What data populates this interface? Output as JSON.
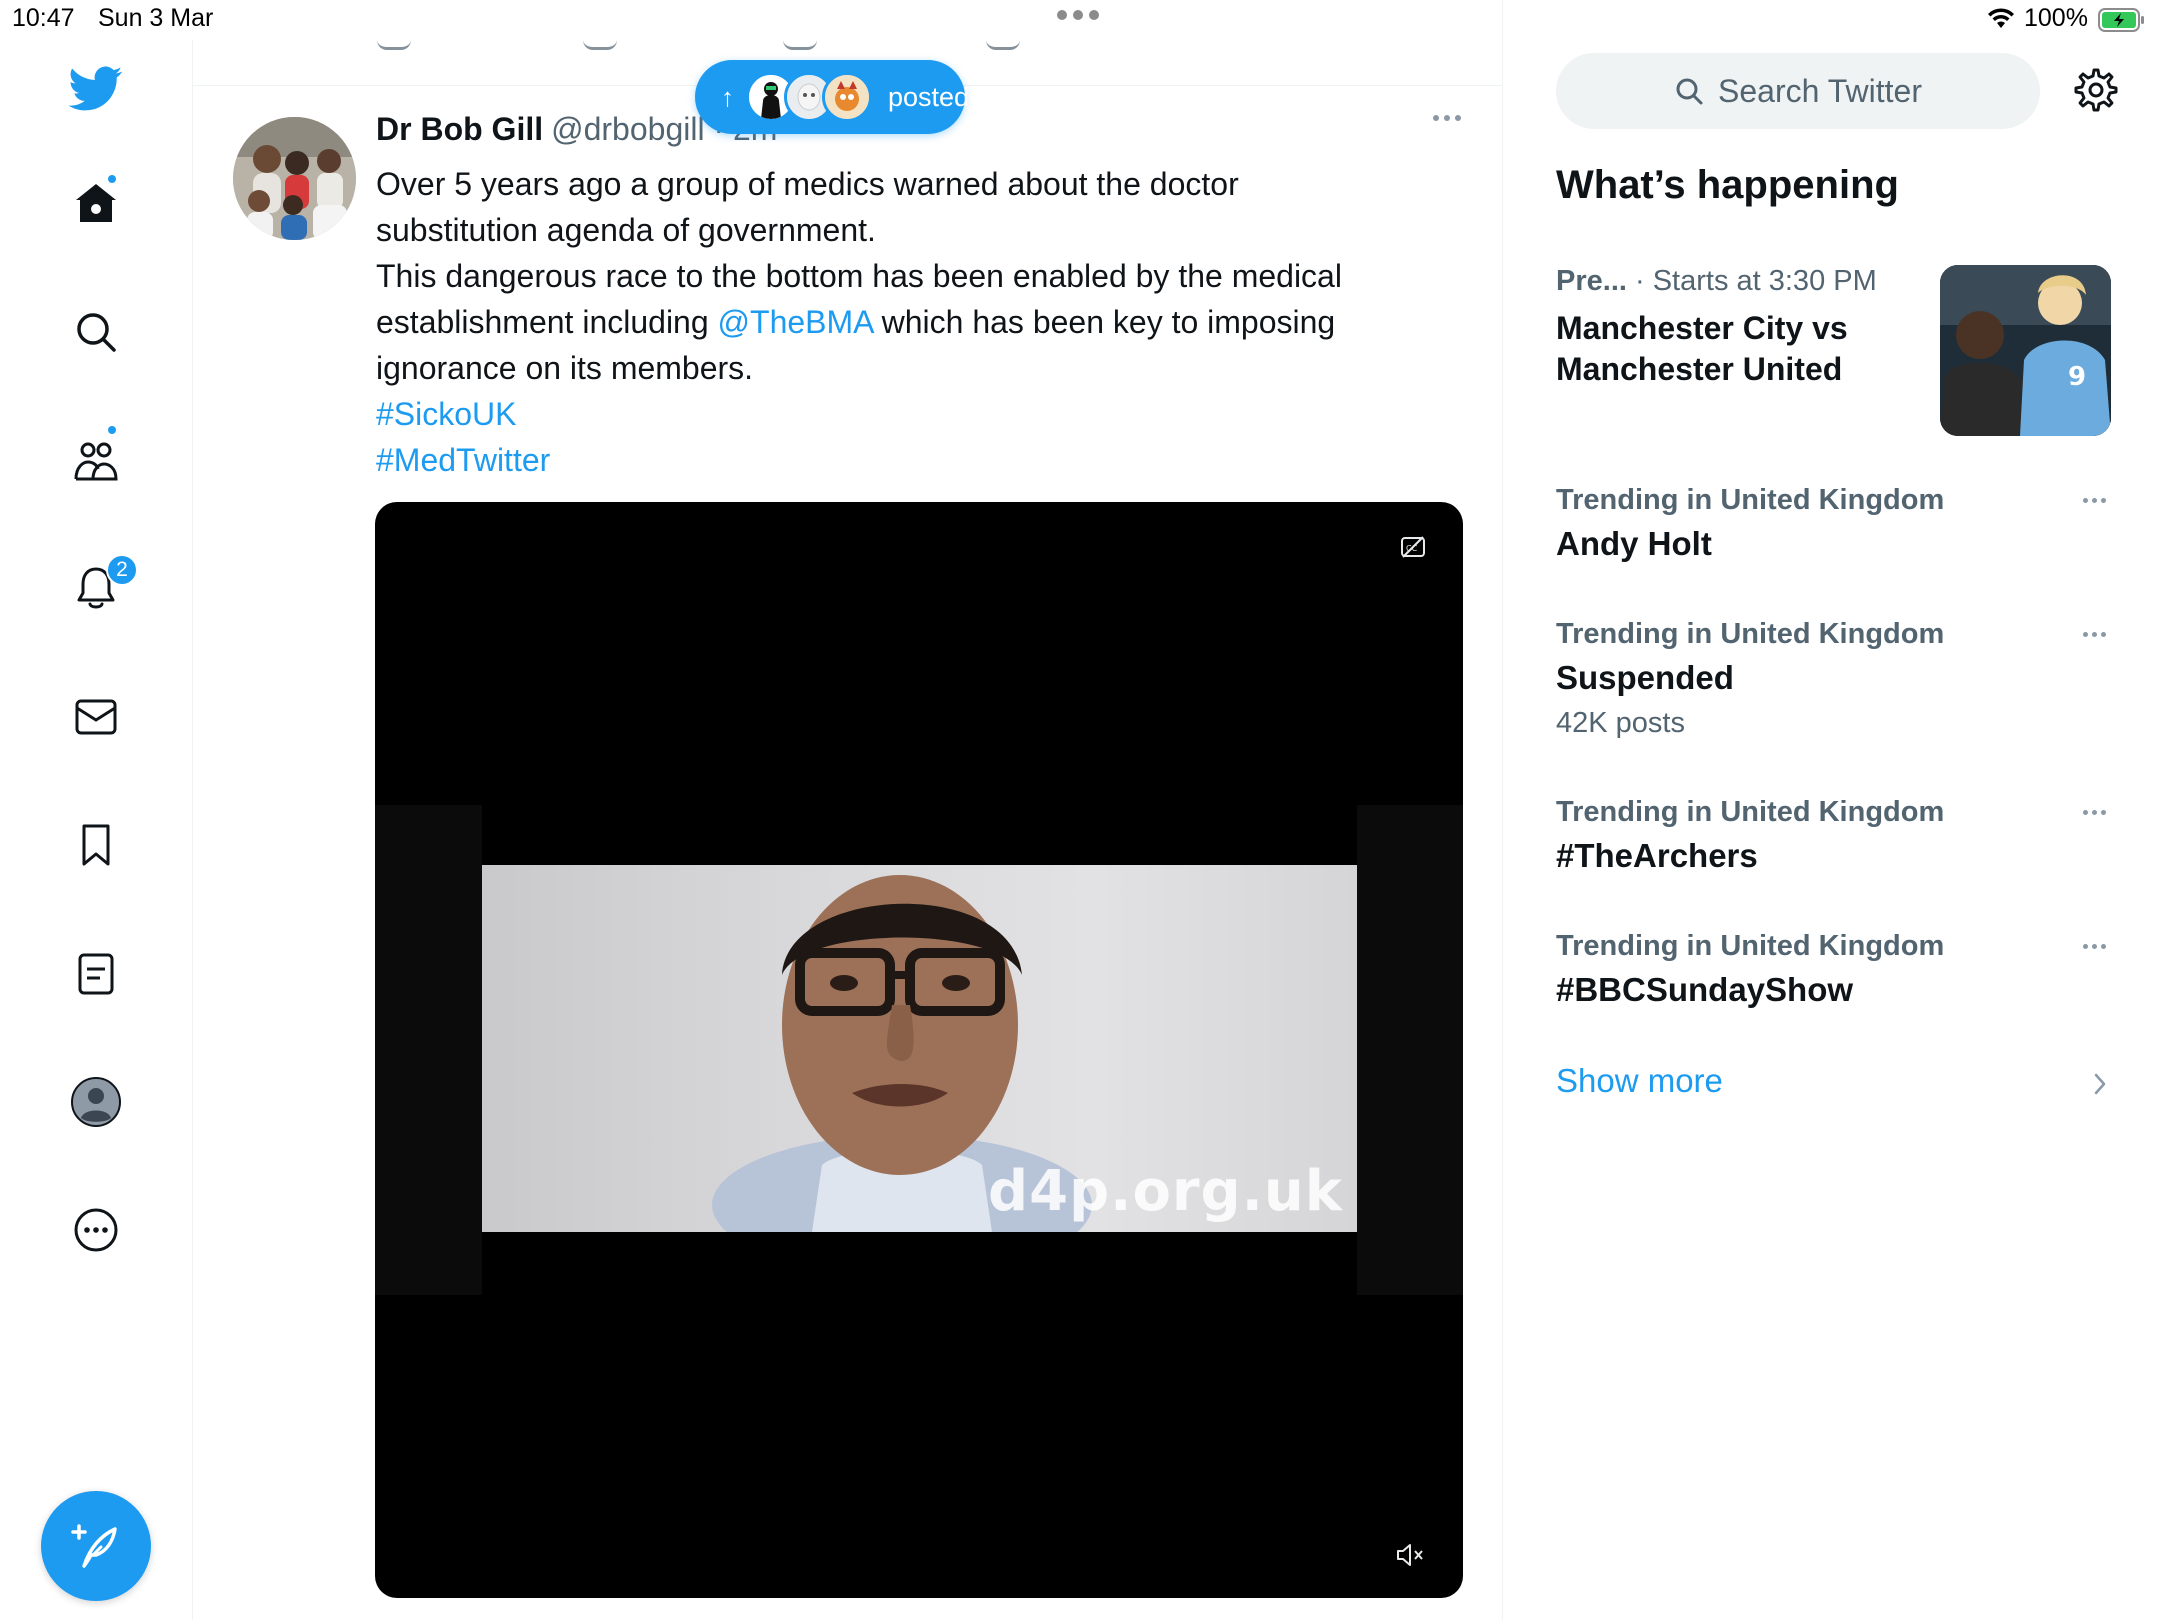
{
  "status_bar": {
    "time": "10:47",
    "date": "Sun 3 Mar",
    "battery": "100%"
  },
  "nav": {
    "items": [
      {
        "name": "logo",
        "icon": "twitter-bird-icon"
      },
      {
        "name": "home",
        "icon": "home-icon",
        "has_dot": true
      },
      {
        "name": "explore",
        "icon": "search-icon"
      },
      {
        "name": "communities",
        "icon": "communities-icon",
        "has_dot": true
      },
      {
        "name": "notifications",
        "icon": "bell-icon",
        "badge": "2"
      },
      {
        "name": "messages",
        "icon": "mail-icon"
      },
      {
        "name": "bookmarks",
        "icon": "bookmark-icon"
      },
      {
        "name": "lists",
        "icon": "list-icon"
      },
      {
        "name": "profile",
        "icon": "avatar-icon"
      },
      {
        "name": "more",
        "icon": "more-circle-icon"
      }
    ],
    "compose_icon": "compose-feather-icon"
  },
  "new_posts_pill": {
    "label": "posted"
  },
  "tweet": {
    "name": "Dr Bob Gill",
    "handle": "@drbobgill · 2m",
    "lines": {
      "l1": "Over 5 years ago a group of medics warned about the doctor",
      "l2": "substitution agenda of government.",
      "l3": "This dangerous race to the bottom has been enabled by the medical",
      "l4_pre": "establishment including ",
      "l4_mention": "@TheBMA",
      "l4_post": " which has been key to imposing",
      "l5": "ignorance on its members."
    },
    "hashtags": [
      "#SickoUK",
      "#MedTwitter"
    ],
    "media": {
      "watermark": "d4p.org.uk"
    }
  },
  "sidebar": {
    "search_placeholder": "Search Twitter",
    "section_title": "What’s happening",
    "featured": {
      "category": "Pre...",
      "time": " · Starts at 3:30 PM",
      "title": "Manchester City vs Manchester United"
    },
    "trends": [
      {
        "context": "Trending in United Kingdom",
        "name": "Andy Holt",
        "count": ""
      },
      {
        "context": "Trending in United Kingdom",
        "name": "Suspended",
        "count": "42K posts"
      },
      {
        "context": "Trending in United Kingdom",
        "name": "#TheArchers",
        "count": ""
      },
      {
        "context": "Trending in United Kingdom",
        "name": "#BBCSundayShow",
        "count": ""
      }
    ],
    "show_more": "Show more"
  },
  "colors": {
    "accent": "#1d9bf0",
    "text_primary": "#0f1419",
    "text_secondary": "#536471"
  }
}
